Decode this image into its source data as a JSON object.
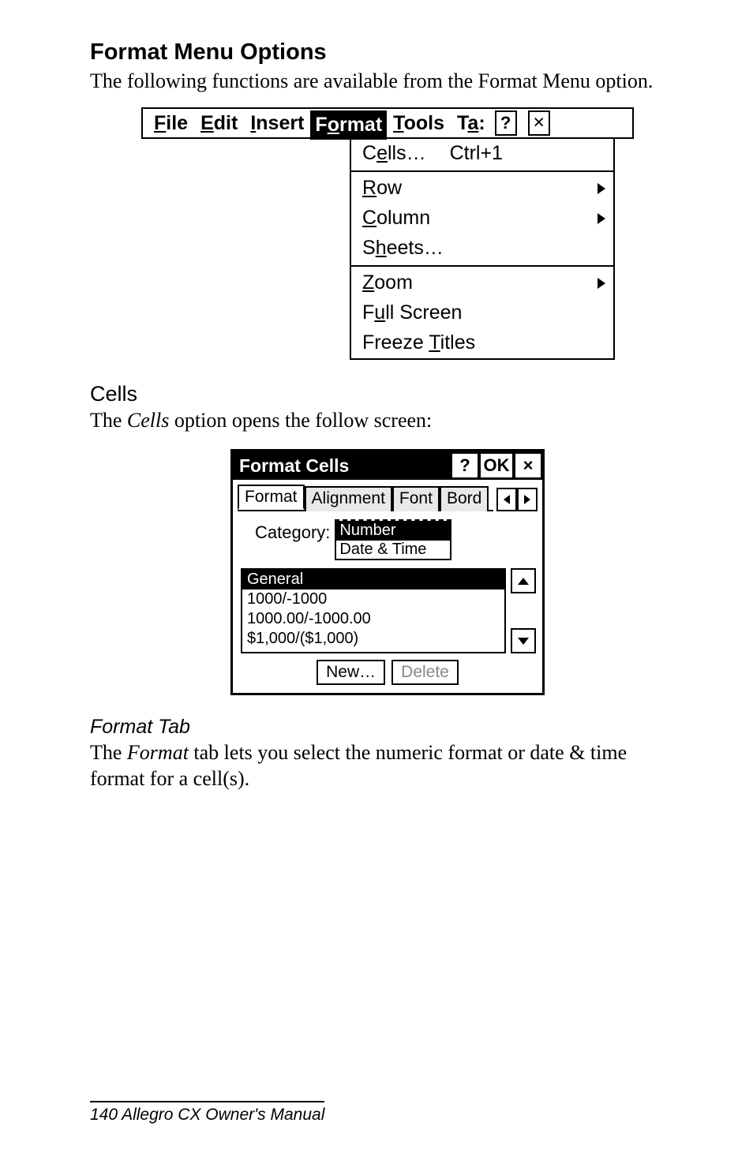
{
  "section_title": "Format Menu Options",
  "intro_text": "The following functions are available from the Format Menu option.",
  "menubar": {
    "file": "File",
    "edit": "Edit",
    "insert": "Insert",
    "format": "Format",
    "tools": "Tools",
    "task": "Ta",
    "help": "?",
    "close": "×"
  },
  "format_menu": {
    "cells": "Cells…",
    "cells_shortcut": "Ctrl+1",
    "row": "Row",
    "column": "Column",
    "sheets": "Sheets…",
    "zoom": "Zoom",
    "full_screen": "Full Screen",
    "freeze_titles": "Freeze Titles"
  },
  "cells_heading": "Cells",
  "cells_intro_prefix": "The ",
  "cells_intro_em": "Cells",
  "cells_intro_suffix": " option opens the follow screen:",
  "dialog": {
    "title": "Format Cells",
    "help": "?",
    "ok": "OK",
    "close": "×",
    "tabs": {
      "format": "Format",
      "alignment": "Alignment",
      "font": "Font",
      "border": "Bord"
    },
    "category_label": "Category:",
    "categories": {
      "number": "Number",
      "datetime": "Date & Time"
    },
    "formats": {
      "general": "General",
      "opt1": "1000/-1000",
      "opt2": "1000.00/-1000.00",
      "opt3": "$1,000/($1,000)"
    },
    "new_btn": "New…",
    "delete_btn": "Delete"
  },
  "format_tab_heading": "Format Tab",
  "format_tab_prefix": "The ",
  "format_tab_em": "Format",
  "format_tab_suffix": " tab lets you select the numeric format or date & time format for a cell(s).",
  "footer": "140    Allegro CX Owner's Manual"
}
